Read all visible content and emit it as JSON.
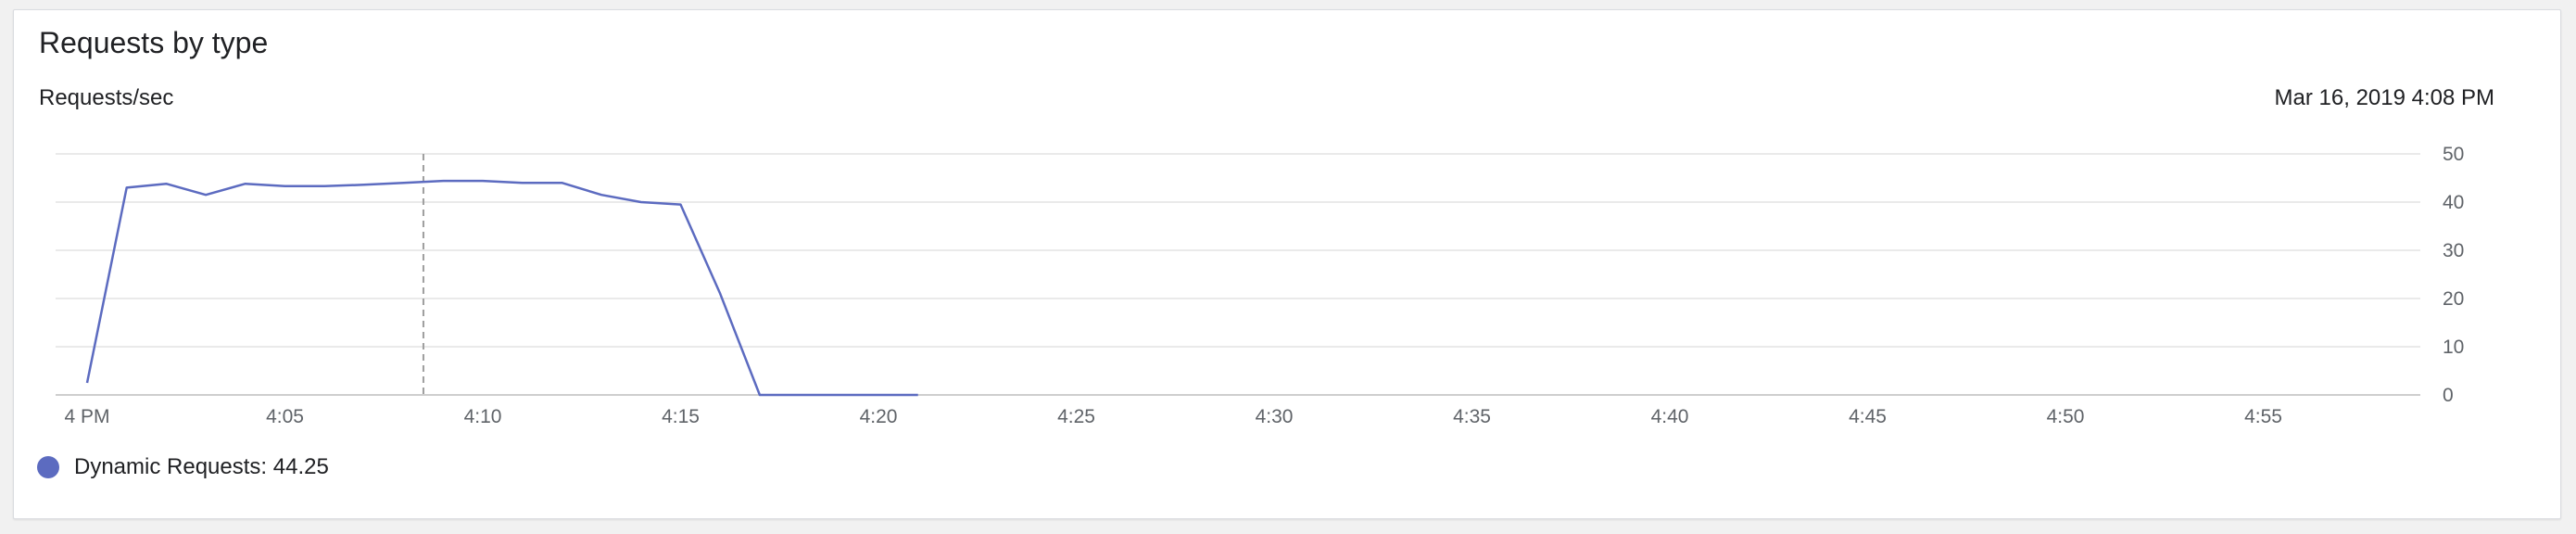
{
  "card": {
    "title": "Requests by type",
    "y_unit": "Requests/sec",
    "timestamp": "Mar 16, 2019 4:08 PM"
  },
  "legend": {
    "series_label": "Dynamic Requests: 44.25",
    "color": "#5c6bc0"
  },
  "chart_data": {
    "type": "line",
    "title": "Requests by type",
    "ylabel": "Requests/sec",
    "xlabel": "",
    "x_unit": "minutes after 4 PM",
    "xlim": [
      0,
      59
    ],
    "ylim": [
      0,
      50
    ],
    "y_ticks": [
      0,
      10,
      20,
      30,
      40,
      50
    ],
    "y_axis_side": "right",
    "x_ticks": [
      {
        "x": 0,
        "label": "4 PM"
      },
      {
        "x": 5,
        "label": "4:05"
      },
      {
        "x": 10,
        "label": "4:10"
      },
      {
        "x": 15,
        "label": "4:15"
      },
      {
        "x": 20,
        "label": "4:20"
      },
      {
        "x": 25,
        "label": "4:25"
      },
      {
        "x": 30,
        "label": "4:30"
      },
      {
        "x": 35,
        "label": "4:35"
      },
      {
        "x": 40,
        "label": "4:40"
      },
      {
        "x": 45,
        "label": "4:45"
      },
      {
        "x": 50,
        "label": "4:50"
      },
      {
        "x": 55,
        "label": "4:55"
      }
    ],
    "grid": true,
    "cursor_x": 8.5,
    "series": [
      {
        "name": "Dynamic Requests",
        "color": "#5c6bc0",
        "x": [
          0,
          1,
          2,
          3,
          4,
          5,
          6,
          7,
          8,
          9,
          10,
          11,
          12,
          13,
          14,
          15,
          16,
          17,
          18,
          19,
          20,
          21
        ],
        "values": [
          2.5,
          43,
          43.8,
          41.5,
          43.8,
          43.3,
          43.3,
          43.6,
          44.0,
          44.4,
          44.4,
          44.0,
          44.0,
          41.5,
          40.0,
          39.5,
          21,
          0,
          0,
          0,
          0,
          0
        ]
      }
    ]
  }
}
